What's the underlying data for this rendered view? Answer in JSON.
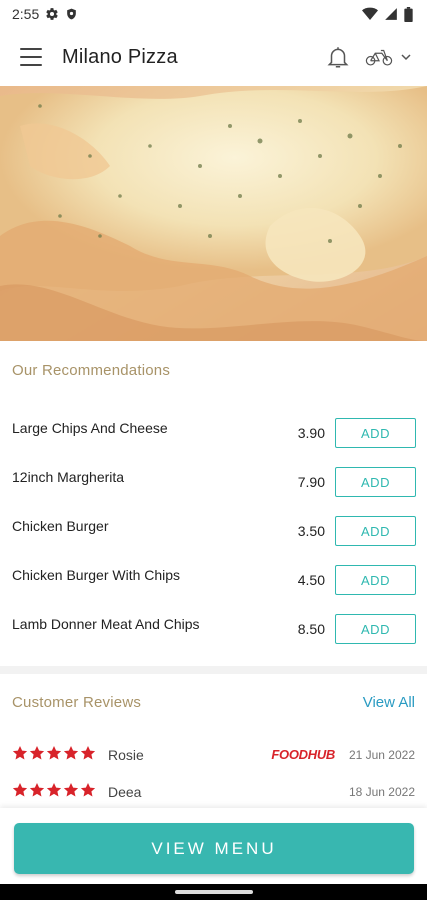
{
  "status": {
    "time": "2:55"
  },
  "header": {
    "title": "Milano Pizza"
  },
  "recommendations": {
    "title": "Our Recommendations",
    "items": [
      {
        "name": "Large Chips And Cheese",
        "price": "3.90",
        "action": "ADD"
      },
      {
        "name": "12inch Margherita",
        "price": "7.90",
        "action": "ADD"
      },
      {
        "name": "Chicken Burger",
        "price": "3.50",
        "action": "ADD"
      },
      {
        "name": "Chicken Burger With Chips",
        "price": "4.50",
        "action": "ADD"
      },
      {
        "name": "Lamb Donner Meat And Chips",
        "price": "8.50",
        "action": "ADD"
      }
    ]
  },
  "reviews": {
    "title": "Customer Reviews",
    "view_all": "View All",
    "items": [
      {
        "name": "Rosie",
        "rating": 5,
        "source": "FOODHUB",
        "date": "21 Jun 2022"
      },
      {
        "name": "Deea",
        "rating": 5,
        "source": "",
        "date": "18 Jun 2022"
      }
    ]
  },
  "footer": {
    "button": "VIEW MENU"
  },
  "colors": {
    "accent": "#38b7b0",
    "gold": "#a89368",
    "star": "#d8232a",
    "link": "#2a9bc2"
  }
}
